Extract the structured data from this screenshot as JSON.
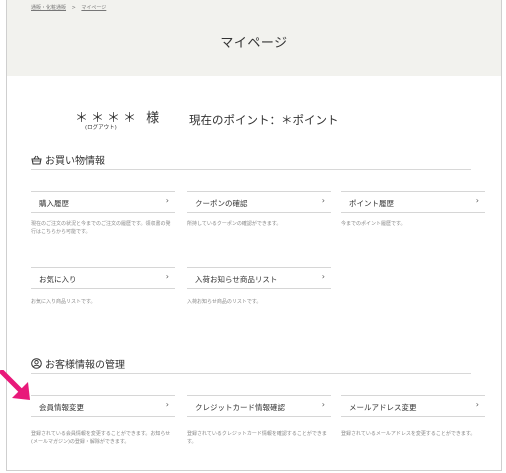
{
  "breadcrumb": {
    "home": "通販・化粧通販",
    "separator": ">",
    "current": "マイページ"
  },
  "page": {
    "title": "マイページ"
  },
  "user": {
    "name": "＊＊＊＊ 様",
    "logout": "(ログアウト)"
  },
  "points": {
    "text": "現在のポイント：＊ポイント"
  },
  "shopping": {
    "heading": "お買い物情報",
    "cards": [
      {
        "label": "購入履歴",
        "desc": "現在のご注文の状況と今までのご注文の履歴です。領収書の発行はこちらから可能です。"
      },
      {
        "label": "クーポンの確認",
        "desc": "所持しているクーポンの確認ができます。"
      },
      {
        "label": "ポイント履歴",
        "desc": "今までのポイント履歴です。"
      },
      {
        "label": "お気に入り",
        "desc": "お気に入り商品リストです。"
      },
      {
        "label": "入荷お知らせ商品リスト",
        "desc": "入荷お知らせ商品のリストです。"
      }
    ]
  },
  "account": {
    "heading": "お客様情報の管理",
    "cards": [
      {
        "label": "会員情報変更",
        "desc": "登録されている会員情報を変更することができます。お知らせ(メールマガジン)の登録・解除ができます。"
      },
      {
        "label": "クレジットカード情報確認",
        "desc": "登録されているクレジットカード情報を確認することができます。"
      },
      {
        "label": "メールアドレス変更",
        "desc": "登録されているメールアドレスを変更することができます。"
      }
    ]
  },
  "icons": {
    "chevron": "chevron-right-icon",
    "basket": "basket-icon",
    "user": "user-circle-icon",
    "arrow": "pink-arrow-icon"
  },
  "colors": {
    "header_bg": "#f2f2ee",
    "arrow": "#e8197a"
  }
}
